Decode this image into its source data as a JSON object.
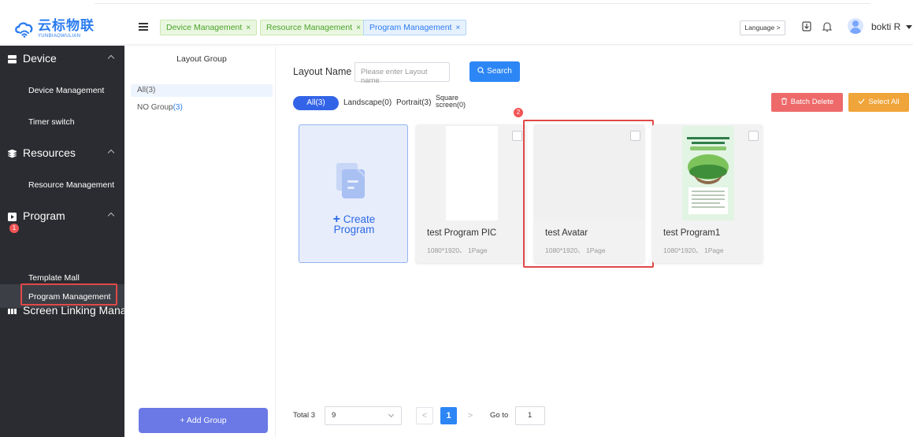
{
  "header": {
    "logo_cn": "云标物联",
    "logo_en": "YUNBIAOWULIAN",
    "tabs": [
      {
        "label": "Device Management",
        "close": "×"
      },
      {
        "label": "Resource Management",
        "close": "×"
      },
      {
        "label": "Program Management",
        "close": "×"
      }
    ],
    "language_label": "Language >",
    "user_name": "bokti R"
  },
  "sidebar": {
    "groups": [
      {
        "label": "Device",
        "icon": "device-icon"
      },
      {
        "label": "Resources",
        "icon": "resources-icon"
      },
      {
        "label": "Program",
        "icon": "program-icon"
      },
      {
        "label": "Screen Linking Mana",
        "icon": "screen-linking-icon"
      }
    ],
    "items": [
      {
        "label": "Device Management"
      },
      {
        "label": "Timer switch"
      },
      {
        "label": "Resource Management"
      },
      {
        "label": "Program Management"
      },
      {
        "label": "Template Mall"
      }
    ]
  },
  "annotations": {
    "badge1": "1",
    "badge2": "2"
  },
  "layout_group": {
    "title": "Layout Group",
    "all_label": "All(3)",
    "no_group_label": "NO Group",
    "no_group_count": "(3)",
    "add_group_label": "+ Add Group"
  },
  "main": {
    "layout_name_label": "Layout Name",
    "search_placeholder": "Please enter Layout name",
    "search_label": "Search",
    "filters": {
      "all": "All(3)",
      "landscape": "Landscape(0)",
      "portrait": "Portrait(3)",
      "square_line1": "Square",
      "square_line2": "screen(0)"
    },
    "batch_delete_label": "Batch Delete",
    "select_all_label": "Select All",
    "create_label_line1": "Create",
    "create_label_line2": "Program",
    "create_plus": "+",
    "programs": [
      {
        "title": "test Program PIC",
        "subtitle": "1080*1920、 1Page"
      },
      {
        "title": "test Avatar",
        "subtitle": "1080*1920、 1Page"
      },
      {
        "title": "test Program1",
        "subtitle": "1080*1920、 1Page"
      }
    ],
    "pagination": {
      "total_label": "Total 3",
      "page_size": "9",
      "prev": "<",
      "current_page": "1",
      "next": ">",
      "goto_label": "Go to",
      "goto_value": "1"
    }
  },
  "colors": {
    "sidebar_bg": "#2b2c31",
    "accent_blue": "#2d86f5",
    "highlight_red": "#e04848",
    "batch_delete": "#ee6a6a",
    "select_all": "#f0a53a",
    "add_group": "#6a79e6"
  }
}
